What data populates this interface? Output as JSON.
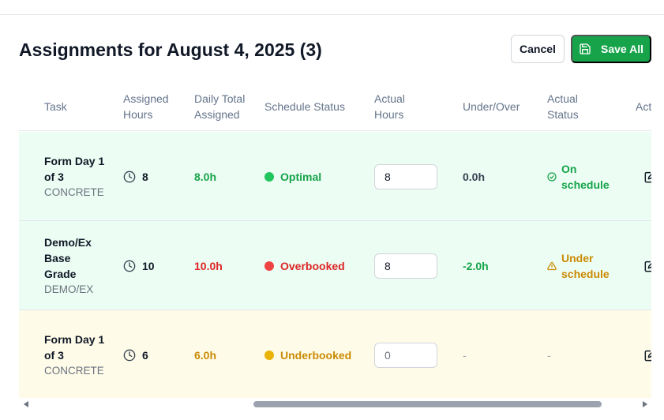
{
  "header": {
    "title": "Assignments for August 4, 2025 (3)",
    "cancel_label": "Cancel",
    "save_label": "Save All"
  },
  "columns": {
    "task": "Task",
    "assigned_hours": "Assigned Hours",
    "daily_total": "Daily Total Assigned",
    "schedule_status": "Schedule Status",
    "actual_hours": "Actual Hours",
    "under_over": "Under/Over",
    "actual_status": "Actual Status",
    "actions": "Actions"
  },
  "rows": [
    {
      "task_name": "Form Day 1 of 3",
      "category": "CONCRETE",
      "assigned_hours": "8",
      "daily_total": "8.0h",
      "schedule_status": "Optimal",
      "actual_hours": "8",
      "under_over": "0.0h",
      "actual_status": "On schedule"
    },
    {
      "task_name": "Demo/Ex Base Grade",
      "category": "DEMO/EX",
      "assigned_hours": "10",
      "daily_total": "10.0h",
      "schedule_status": "Overbooked",
      "actual_hours": "8",
      "under_over": "-2.0h",
      "actual_status": "Under schedule"
    },
    {
      "task_name": "Form Day 1 of 3",
      "category": "CONCRETE",
      "assigned_hours": "6",
      "daily_total": "6.0h",
      "schedule_status": "Underbooked",
      "actual_hours_placeholder": "0",
      "under_over": "-",
      "actual_status": "-"
    }
  ],
  "colors": {
    "accent_green": "#16a34a",
    "status_red": "#dc2626",
    "status_yellow": "#ca8a04",
    "row_green_bg": "#ecfdf3",
    "row_yellow_bg": "#fefce8"
  },
  "icons": [
    "save-icon",
    "clock-icon",
    "check-circle-icon",
    "warning-triangle-icon",
    "edit-icon",
    "scroll-left-arrow-icon",
    "scroll-right-arrow-icon"
  ]
}
